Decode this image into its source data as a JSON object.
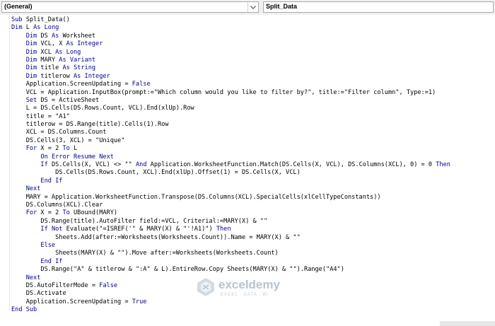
{
  "header": {
    "object_dropdown": "(General)",
    "procedure_dropdown": "Split_Data"
  },
  "code_lines": [
    {
      "indent": 0,
      "text": "Sub Split_Data()"
    },
    {
      "indent": 0,
      "text": "Dim L As Long"
    },
    {
      "indent": 1,
      "text": "Dim DS As Worksheet"
    },
    {
      "indent": 1,
      "text": "Dim VCL, X As Integer"
    },
    {
      "indent": 1,
      "text": "Dim XCL As Long"
    },
    {
      "indent": 1,
      "text": "Dim MARY As Variant"
    },
    {
      "indent": 1,
      "text": "Dim title As String"
    },
    {
      "indent": 1,
      "text": "Dim titlerow As Integer"
    },
    {
      "indent": 1,
      "text": "Application.ScreenUpdating = False"
    },
    {
      "indent": 1,
      "text": "VCL = Application.InputBox(prompt:=\"Which column would you like to filter by?\", title:=\"Filter column\", Type:=1)"
    },
    {
      "indent": 1,
      "text": "Set DS = ActiveSheet"
    },
    {
      "indent": 1,
      "text": "L = DS.Cells(DS.Rows.Count, VCL).End(xlUp).Row"
    },
    {
      "indent": 1,
      "text": "title = \"A1\""
    },
    {
      "indent": 1,
      "text": "titlerow = DS.Range(title).Cells(1).Row"
    },
    {
      "indent": 1,
      "text": "XCL = DS.Columns.Count"
    },
    {
      "indent": 1,
      "text": "DS.Cells(3, XCL) = \"Unique\""
    },
    {
      "indent": 1,
      "text": "For X = 2 To L"
    },
    {
      "indent": 2,
      "text": "On Error Resume Next"
    },
    {
      "indent": 2,
      "text": "If DS.Cells(X, VCL) <> \"\" And Application.WorksheetFunction.Match(DS.Cells(X, VCL), DS.Columns(XCL), 0) = 0 Then"
    },
    {
      "indent": 3,
      "text": "DS.Cells(DS.Rows.Count, XCL).End(xlUp).Offset(1) = DS.Cells(X, VCL)"
    },
    {
      "indent": 2,
      "text": "End If"
    },
    {
      "indent": 1,
      "text": "Next"
    },
    {
      "indent": 1,
      "text": "MARY = Application.WorksheetFunction.Transpose(DS.Columns(XCL).SpecialCells(xlCellTypeConstants))"
    },
    {
      "indent": 1,
      "text": "DS.Columns(XCL).Clear"
    },
    {
      "indent": 1,
      "text": "For X = 2 To UBound(MARY)"
    },
    {
      "indent": 2,
      "text": "DS.Range(title).AutoFilter field:=VCL, Criterial:=MARY(X) & \"\""
    },
    {
      "indent": 2,
      "text": "If Not Evaluate(\"=ISREF('\" & MARY(X) & \"'!A1)\") Then"
    },
    {
      "indent": 3,
      "text": "Sheets.Add(after:=Worksheets(Worksheets.Count)).Name = MARY(X) & \"\""
    },
    {
      "indent": 2,
      "text": "Else"
    },
    {
      "indent": 3,
      "text": "Sheets(MARY(X) & \"\").Move after:=Worksheets(Worksheets.Count)"
    },
    {
      "indent": 2,
      "text": "End If"
    },
    {
      "indent": 2,
      "text": "DS.Range(\"A\" & titlerow & \":A\" & L).EntireRow.Copy Sheets(MARY(X) & \"\").Range(\"A4\")"
    },
    {
      "indent": 1,
      "text": "Next"
    },
    {
      "indent": 1,
      "text": "DS.AutoFilterMode = False"
    },
    {
      "indent": 1,
      "text": "DS.Activate"
    },
    {
      "indent": 1,
      "text": "Application.ScreenUpdating = True"
    },
    {
      "indent": 0,
      "text": "End Sub"
    }
  ],
  "keywords": [
    "Sub",
    "End Sub",
    "Dim",
    "As",
    "Long",
    "Integer",
    "Variant",
    "String",
    "False",
    "True",
    "Set",
    "For",
    "To",
    "Next",
    "On",
    "Error",
    "Resume",
    "If",
    "And",
    "Then",
    "End If",
    "Not",
    "Else"
  ],
  "watermark": {
    "name": "exceldemy",
    "tagline": "EXCEL · DATA · BI"
  },
  "colors": {
    "keyword": "#00008b",
    "text": "#000000",
    "background": "#ffffff"
  }
}
